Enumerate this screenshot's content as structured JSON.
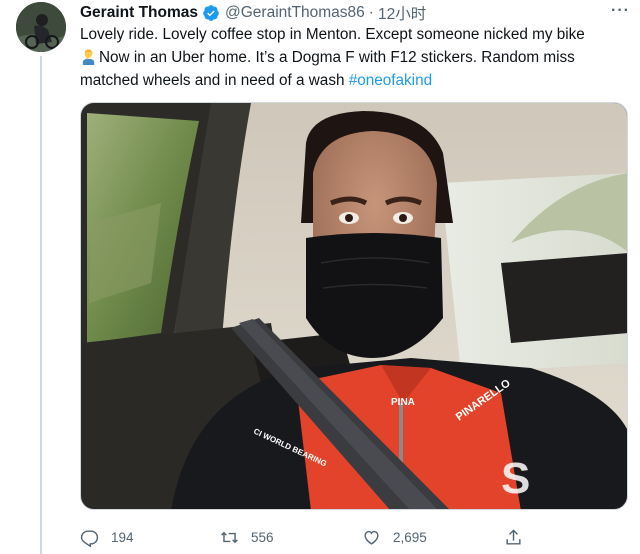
{
  "tweet": {
    "author_name": "Geraint Thomas",
    "author_handle": "@GeraintThomas86",
    "separator": "·",
    "timestamp": "12小时",
    "text_line1": "Lovely ride. Lovely coffee stop in Menton. Except someone nicked my bike",
    "text_line2": "Now in an Uber home. It’s a Dogma F with F12 stickers. Random miss",
    "text_line3_prefix": "matched wheels and in need of a wash ",
    "hashtag": "#oneofakind",
    "more_label": "···",
    "photo_caption_texts": {
      "jersey_brand_chest": "PINA",
      "jersey_brand_arm": "PINARELLO",
      "sponsor_chest": "CI WORLD BEARING",
      "sponsor_arm": "S"
    }
  },
  "actions": {
    "reply_count": "194",
    "retweet_count": "556",
    "like_count": "2,695"
  },
  "icons": {
    "verified": "verified-badge-icon",
    "emoji": "man-facepalming-emoji",
    "reply": "reply-icon",
    "retweet": "retweet-icon",
    "like": "heart-icon",
    "share": "share-icon"
  },
  "colors": {
    "link": "#1d9bf0",
    "verified": "#1d9bf0",
    "secondary_text": "#536471",
    "primary_text": "#0f1419"
  }
}
